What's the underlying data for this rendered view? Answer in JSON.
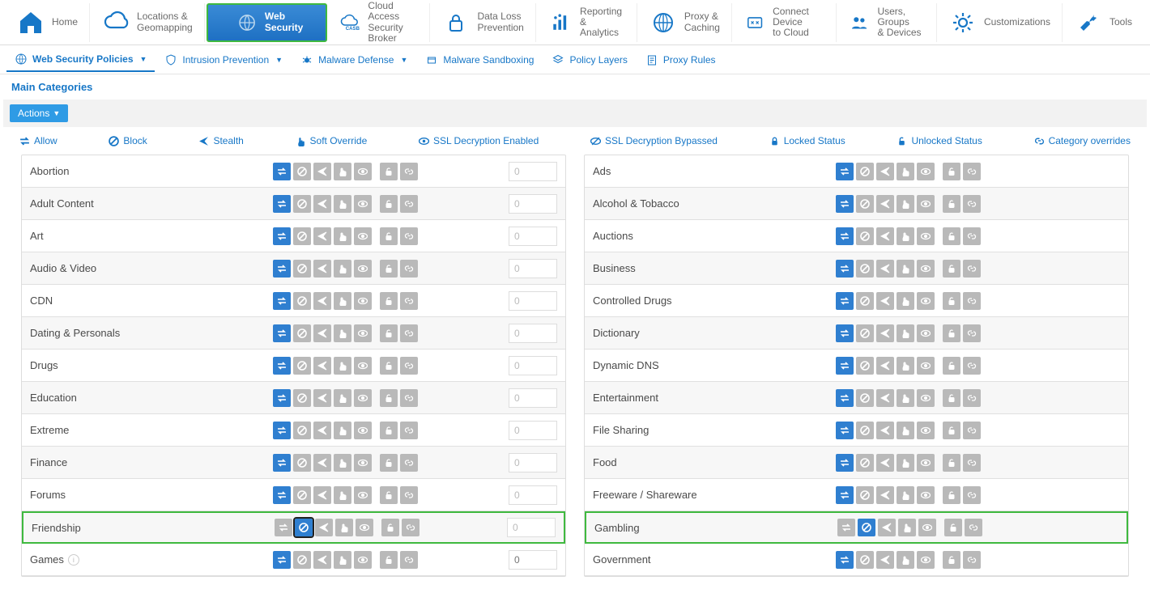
{
  "topnav": [
    {
      "id": "home",
      "line1": "Home",
      "line2": "",
      "icon": "home"
    },
    {
      "id": "locations",
      "line1": "Locations &",
      "line2": "Geomapping",
      "icon": "cloud"
    },
    {
      "id": "websec",
      "line1": "Web Security",
      "line2": "",
      "icon": "globe",
      "active": true
    },
    {
      "id": "casb",
      "line1": "Cloud Access",
      "line2": "Security Broker",
      "icon": "casb"
    },
    {
      "id": "dlp",
      "line1": "Data Loss",
      "line2": "Prevention",
      "icon": "lock"
    },
    {
      "id": "reporting",
      "line1": "Reporting &",
      "line2": "Analytics",
      "icon": "chart"
    },
    {
      "id": "proxy",
      "line1": "Proxy &",
      "line2": "Caching",
      "icon": "globe2"
    },
    {
      "id": "connect",
      "line1": "Connect Device",
      "line2": "to Cloud",
      "icon": "connect"
    },
    {
      "id": "users",
      "line1": "Users, Groups",
      "line2": "& Devices",
      "icon": "users"
    },
    {
      "id": "custom",
      "line1": "Customizations",
      "line2": "",
      "icon": "gear"
    },
    {
      "id": "tools",
      "line1": "Tools",
      "line2": "",
      "icon": "wrench"
    }
  ],
  "subnav": [
    {
      "id": "wsp",
      "label": "Web Security Policies",
      "icon": "globe",
      "caret": true,
      "active": true
    },
    {
      "id": "ips",
      "label": "Intrusion Prevention",
      "icon": "shield",
      "caret": true
    },
    {
      "id": "mal",
      "label": "Malware Defense",
      "icon": "bug",
      "caret": true
    },
    {
      "id": "sand",
      "label": "Malware Sandboxing",
      "icon": "box"
    },
    {
      "id": "layers",
      "label": "Policy Layers",
      "icon": "layers"
    },
    {
      "id": "rules",
      "label": "Proxy Rules",
      "icon": "rules"
    }
  ],
  "page_title": "Main Categories",
  "actions_label": "Actions",
  "legend": [
    {
      "id": "allow",
      "label": "Allow",
      "icon": "swap"
    },
    {
      "id": "block",
      "label": "Block",
      "icon": "noentry"
    },
    {
      "id": "stealth",
      "label": "Stealth",
      "icon": "plane"
    },
    {
      "id": "soft",
      "label": "Soft Override",
      "icon": "hand"
    },
    {
      "id": "sslen",
      "label": "SSL Decryption Enabled",
      "icon": "eye"
    },
    {
      "id": "sslby",
      "label": "SSL Decryption Bypassed",
      "icon": "eyeoff"
    },
    {
      "id": "locked",
      "label": "Locked Status",
      "icon": "lock"
    },
    {
      "id": "unlocked",
      "label": "Unlocked Status",
      "icon": "unlock"
    },
    {
      "id": "catov",
      "label": "Category overrides",
      "icon": "link"
    }
  ],
  "icon_order": [
    "swap",
    "noentry",
    "plane",
    "hand",
    "eye",
    "unlock",
    "link"
  ],
  "left_categories": [
    {
      "name": "Abortion",
      "count": "0",
      "active": [
        0
      ]
    },
    {
      "name": "Adult Content",
      "count": "0",
      "active": [
        0
      ]
    },
    {
      "name": "Art",
      "count": "0",
      "active": [
        0
      ]
    },
    {
      "name": "Audio & Video",
      "count": "0",
      "active": [
        0
      ]
    },
    {
      "name": "CDN",
      "count": "0",
      "active": [
        0
      ]
    },
    {
      "name": "Dating & Personals",
      "count": "0",
      "active": [
        0
      ]
    },
    {
      "name": "Drugs",
      "count": "0",
      "active": [
        0
      ]
    },
    {
      "name": "Education",
      "count": "0",
      "active": [
        0
      ]
    },
    {
      "name": "Extreme",
      "count": "0",
      "active": [
        0
      ]
    },
    {
      "name": "Finance",
      "count": "0",
      "active": [
        0
      ]
    },
    {
      "name": "Forums",
      "count": "0",
      "active": [
        0
      ]
    },
    {
      "name": "Friendship",
      "count": "0",
      "active": [
        1
      ],
      "highlight": true,
      "selected": 1,
      "dim0": true
    },
    {
      "name": "Games",
      "count": "",
      "active": [
        0
      ],
      "info": true
    }
  ],
  "right_categories": [
    {
      "name": "Ads",
      "active": [
        0
      ]
    },
    {
      "name": "Alcohol & Tobacco",
      "active": [
        0
      ]
    },
    {
      "name": "Auctions",
      "active": [
        0
      ]
    },
    {
      "name": "Business",
      "active": [
        0
      ]
    },
    {
      "name": "Controlled Drugs",
      "active": [
        0
      ]
    },
    {
      "name": "Dictionary",
      "active": [
        0
      ]
    },
    {
      "name": "Dynamic DNS",
      "active": [
        0
      ]
    },
    {
      "name": "Entertainment",
      "active": [
        0
      ]
    },
    {
      "name": "File Sharing",
      "active": [
        0
      ]
    },
    {
      "name": "Food",
      "active": [
        0
      ]
    },
    {
      "name": "Freeware / Shareware",
      "active": [
        0
      ]
    },
    {
      "name": "Gambling",
      "active": [
        1
      ],
      "highlight": true,
      "dim0": true
    },
    {
      "name": "Government",
      "active": [
        0
      ]
    }
  ]
}
